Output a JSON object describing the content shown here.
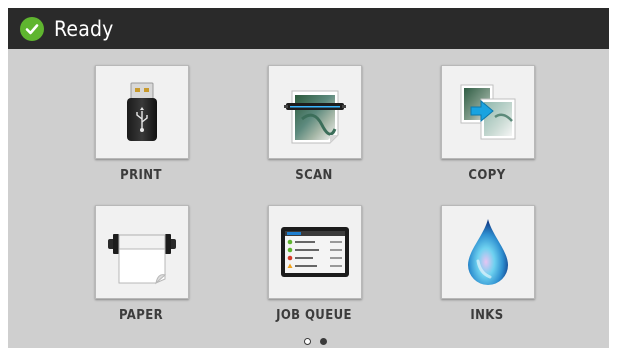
{
  "status": {
    "text": "Ready",
    "icon": "checkmark-circle-icon",
    "color": "#5fb52f"
  },
  "tiles": [
    {
      "id": "print",
      "label": "PRINT",
      "icon": "usb-drive-icon"
    },
    {
      "id": "scan",
      "label": "SCAN",
      "icon": "scan-icon"
    },
    {
      "id": "copy",
      "label": "COPY",
      "icon": "copy-icon"
    },
    {
      "id": "paper",
      "label": "PAPER",
      "icon": "paper-roll-icon"
    },
    {
      "id": "job_queue",
      "label": "JOB QUEUE",
      "icon": "job-queue-icon"
    },
    {
      "id": "inks",
      "label": "INKS",
      "icon": "ink-drop-icon"
    }
  ],
  "pagination": {
    "total": 2,
    "current": 1
  }
}
